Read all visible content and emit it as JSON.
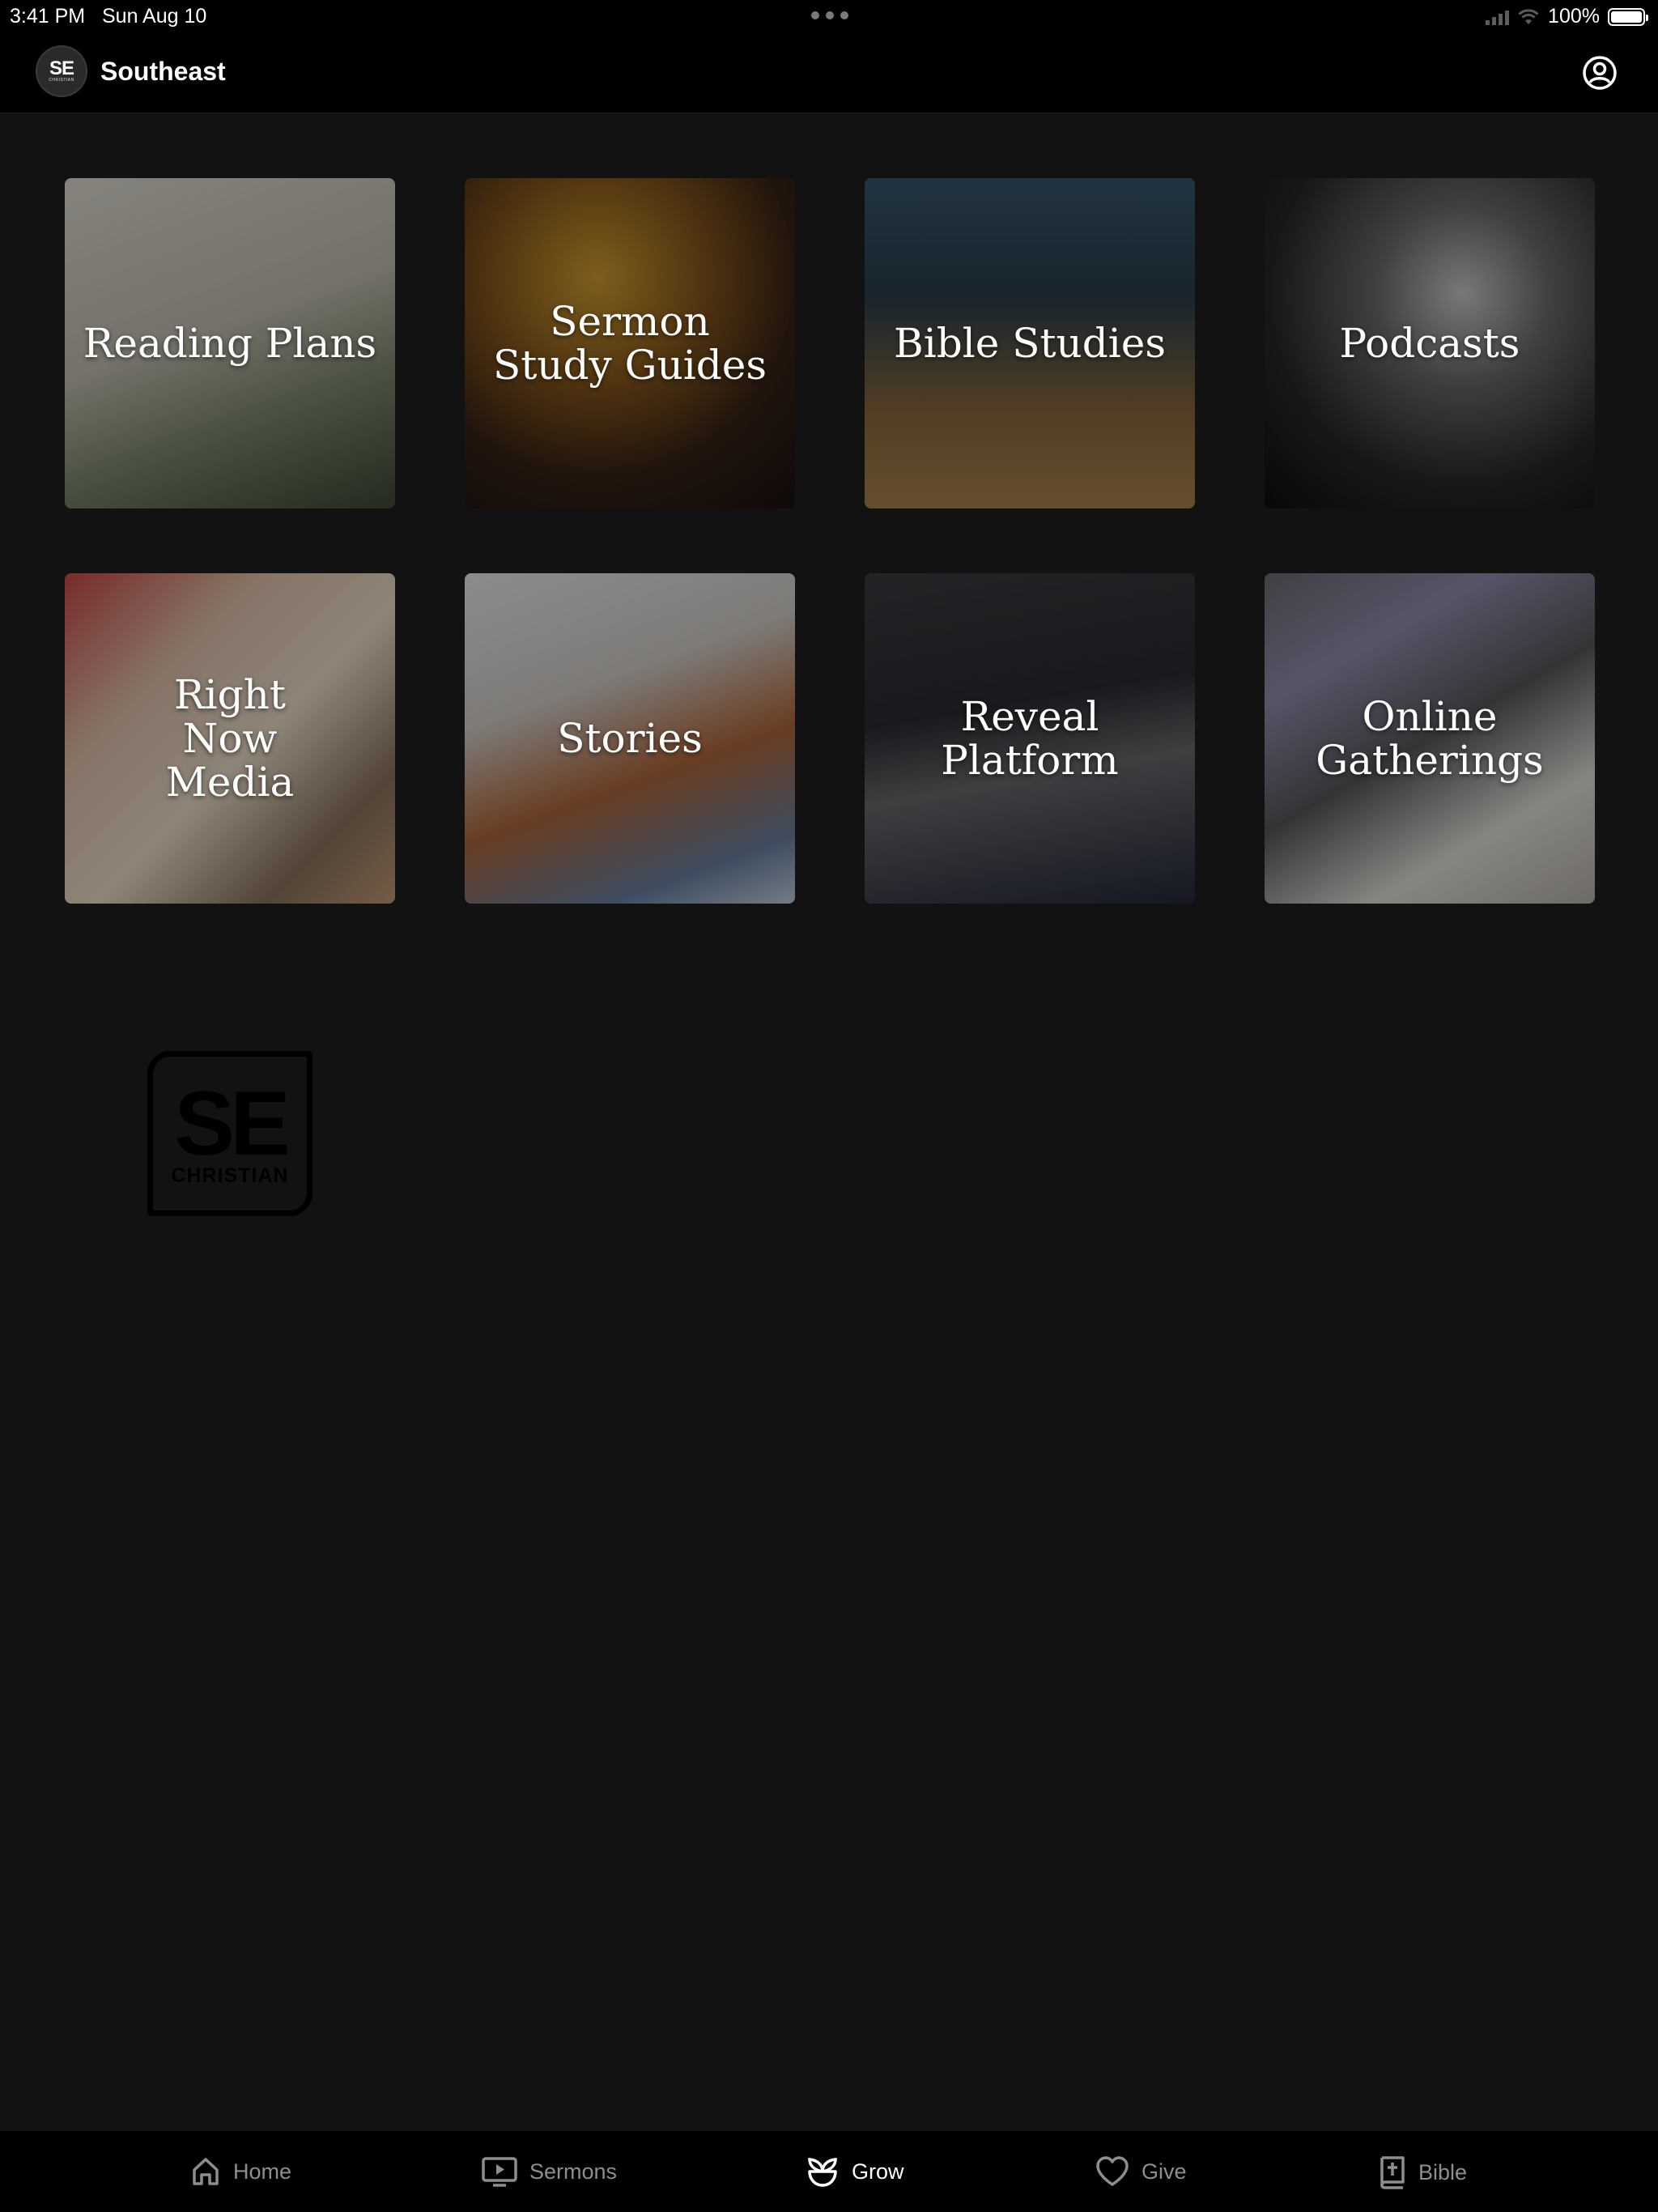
{
  "status_bar": {
    "time": "3:41 PM",
    "date": "Sun Aug 10",
    "battery_text": "100%",
    "battery_level": 1.0
  },
  "header": {
    "logo_text": "SE",
    "logo_subtext": "CHRISTIAN",
    "title": "Southeast",
    "profile_icon": "user-circle-icon"
  },
  "tiles": [
    {
      "label": "Reading Plans"
    },
    {
      "label": "Sermon Study Guides"
    },
    {
      "label": "Bible Studies"
    },
    {
      "label": "Podcasts"
    },
    {
      "label": "Right Now Media"
    },
    {
      "label": "Stories"
    },
    {
      "label": "Reveal Platform"
    },
    {
      "label": "Online Gatherings"
    }
  ],
  "footer_logo": {
    "text": "SE",
    "subtext": "CHRISTIAN"
  },
  "tab_bar": {
    "active": "Grow",
    "items": [
      {
        "label": "Home",
        "icon": "home-icon"
      },
      {
        "label": "Sermons",
        "icon": "tv-play-icon"
      },
      {
        "label": "Grow",
        "icon": "sprout-icon"
      },
      {
        "label": "Give",
        "icon": "heart-icon"
      },
      {
        "label": "Bible",
        "icon": "bible-icon"
      }
    ]
  },
  "colors": {
    "background": "#121212",
    "bar": "#000000",
    "tab_inactive": "#8e8e8e",
    "tab_active": "#ffffff"
  }
}
